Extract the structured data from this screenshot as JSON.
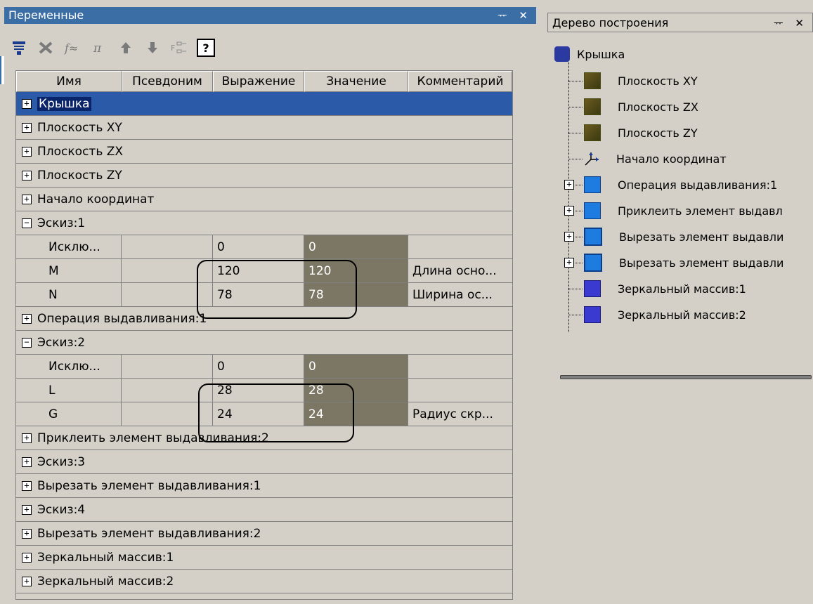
{
  "variables_panel": {
    "title": "Переменные",
    "header_buttons": "ᅲ ✕",
    "toolbar": [
      {
        "icon": "variables-table-icon"
      },
      {
        "icon": "delete-icon"
      },
      {
        "icon": "function-icon"
      },
      {
        "icon": "pi-icon"
      },
      {
        "icon": "arrow-up-icon"
      },
      {
        "icon": "arrow-down-icon"
      },
      {
        "icon": "filter-icon"
      },
      {
        "icon": "help-icon"
      }
    ],
    "columns": [
      "Имя",
      "Псевдоним",
      "Выражение",
      "Значение",
      "Комментарий"
    ],
    "rows": [
      {
        "type": "group",
        "expander": "⊞",
        "label": "Крышка",
        "selected": true
      },
      {
        "type": "group",
        "expander": "⊞",
        "label": "Плоскость XY"
      },
      {
        "type": "group",
        "expander": "⊞",
        "label": "Плоскость ZX"
      },
      {
        "type": "group",
        "expander": "⊞",
        "label": "Плоскость ZY"
      },
      {
        "type": "group",
        "expander": "⊞",
        "label": "Начало координат"
      },
      {
        "type": "group",
        "expander": "⊟",
        "label": "Эскиз:1"
      },
      {
        "type": "data",
        "name": "Исклю...",
        "alias": "",
        "expression": "0",
        "value": "0",
        "comment": ""
      },
      {
        "type": "data",
        "name": "M",
        "alias": "",
        "expression": "120",
        "value": "120",
        "comment": "Длина осно..."
      },
      {
        "type": "data",
        "name": "N",
        "alias": "",
        "expression": "78",
        "value": "78",
        "comment": "Ширина ос..."
      },
      {
        "type": "group",
        "expander": "⊞",
        "label": "Операция выдавливания:1"
      },
      {
        "type": "group",
        "expander": "⊟",
        "label": "Эскиз:2"
      },
      {
        "type": "data",
        "name": "Исклю...",
        "alias": "",
        "expression": "0",
        "value": "0",
        "comment": ""
      },
      {
        "type": "data",
        "name": "L",
        "alias": "",
        "expression": "28",
        "value": "28",
        "comment": ""
      },
      {
        "type": "data",
        "name": "G",
        "alias": "",
        "expression": "24",
        "value": "24",
        "comment": "Радиус скр..."
      },
      {
        "type": "group",
        "expander": "⊞",
        "label": "Приклеить элемент выдавливания:2"
      },
      {
        "type": "group",
        "expander": "⊞",
        "label": "Эскиз:3"
      },
      {
        "type": "group",
        "expander": "⊞",
        "label": "Вырезать элемент выдавливания:1"
      },
      {
        "type": "group",
        "expander": "⊞",
        "label": "Эскиз:4"
      },
      {
        "type": "group",
        "expander": "⊞",
        "label": "Вырезать элемент выдавливания:2"
      },
      {
        "type": "group",
        "expander": "⊞",
        "label": "Зеркальный массив:1"
      },
      {
        "type": "group",
        "expander": "⊞",
        "label": "Зеркальный массив:2"
      }
    ]
  },
  "tree_panel": {
    "title": "Дерево построения",
    "header_buttons": "ᅲ ✕",
    "root": {
      "label": "Крышка",
      "icon": "part-icon"
    },
    "items": [
      {
        "label": "Плоскость XY",
        "icon": "plane-icon",
        "expandable": false
      },
      {
        "label": "Плоскость ZX",
        "icon": "plane-icon",
        "expandable": false
      },
      {
        "label": "Плоскость ZY",
        "icon": "plane-icon",
        "expandable": false
      },
      {
        "label": "Начало координат",
        "icon": "origin-icon",
        "expandable": false
      },
      {
        "label": "Операция выдавливания:1",
        "icon": "extrude-icon",
        "expandable": true
      },
      {
        "label": "Приклеить элемент выдавл",
        "icon": "boss-extrude-icon",
        "expandable": true
      },
      {
        "label": "Вырезать элемент выдавли",
        "icon": "cut-extrude-icon",
        "expandable": true
      },
      {
        "label": "Вырезать элемент выдавли",
        "icon": "cut-extrude-icon",
        "expandable": true
      },
      {
        "label": "Зеркальный массив:1",
        "icon": "mirror-icon",
        "expandable": false
      },
      {
        "label": "Зеркальный массив:2",
        "icon": "mirror-icon",
        "expandable": false
      }
    ]
  }
}
